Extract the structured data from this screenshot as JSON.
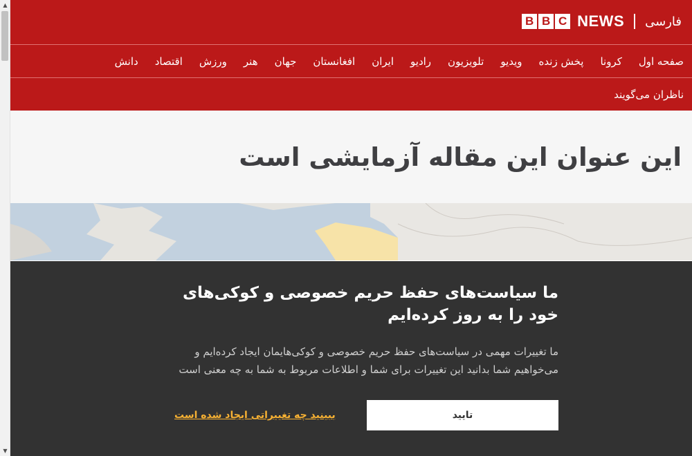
{
  "header": {
    "language_label": "فارسی",
    "brand_letters": [
      "B",
      "B",
      "C"
    ],
    "brand_news": "NEWS"
  },
  "nav": {
    "items": [
      "صفحه اول",
      "کرونا",
      "پخش زنده",
      "ویدیو",
      "تلویزیون",
      "رادیو",
      "ایران",
      "افغانستان",
      "جهان",
      "هنر",
      "ورزش",
      "اقتصاد",
      "دانش"
    ],
    "row2_items": [
      "ناظران می‌گویند"
    ]
  },
  "article": {
    "headline": "این عنوان این مقاله آزمایشی است"
  },
  "cookie_banner": {
    "title": "ما سیاست‌های حفظ حریم خصوصی و کوکی‌های خود را به روز کرده‌ایم",
    "body": "ما تغییرات مهمی در سیاست‌های حفظ حریم خصوصی و کوکی‌هایمان ایجاد کرده‌ایم و می‌خواهیم شما بدانید این تغییرات برای شما و اطلاعات مربوط به شما به چه معنی است",
    "accept_label": "تایید",
    "changes_link_label": "ببینید چه تغییراتی ایجاد شده است"
  },
  "colors": {
    "brand_red": "#bb1919",
    "banner_bg": "#323232",
    "link_orange": "#f9b233",
    "headline_text": "#3f3f42"
  },
  "icons": {
    "scroll_up": "triangle-up-icon",
    "scroll_down": "triangle-down-icon"
  }
}
